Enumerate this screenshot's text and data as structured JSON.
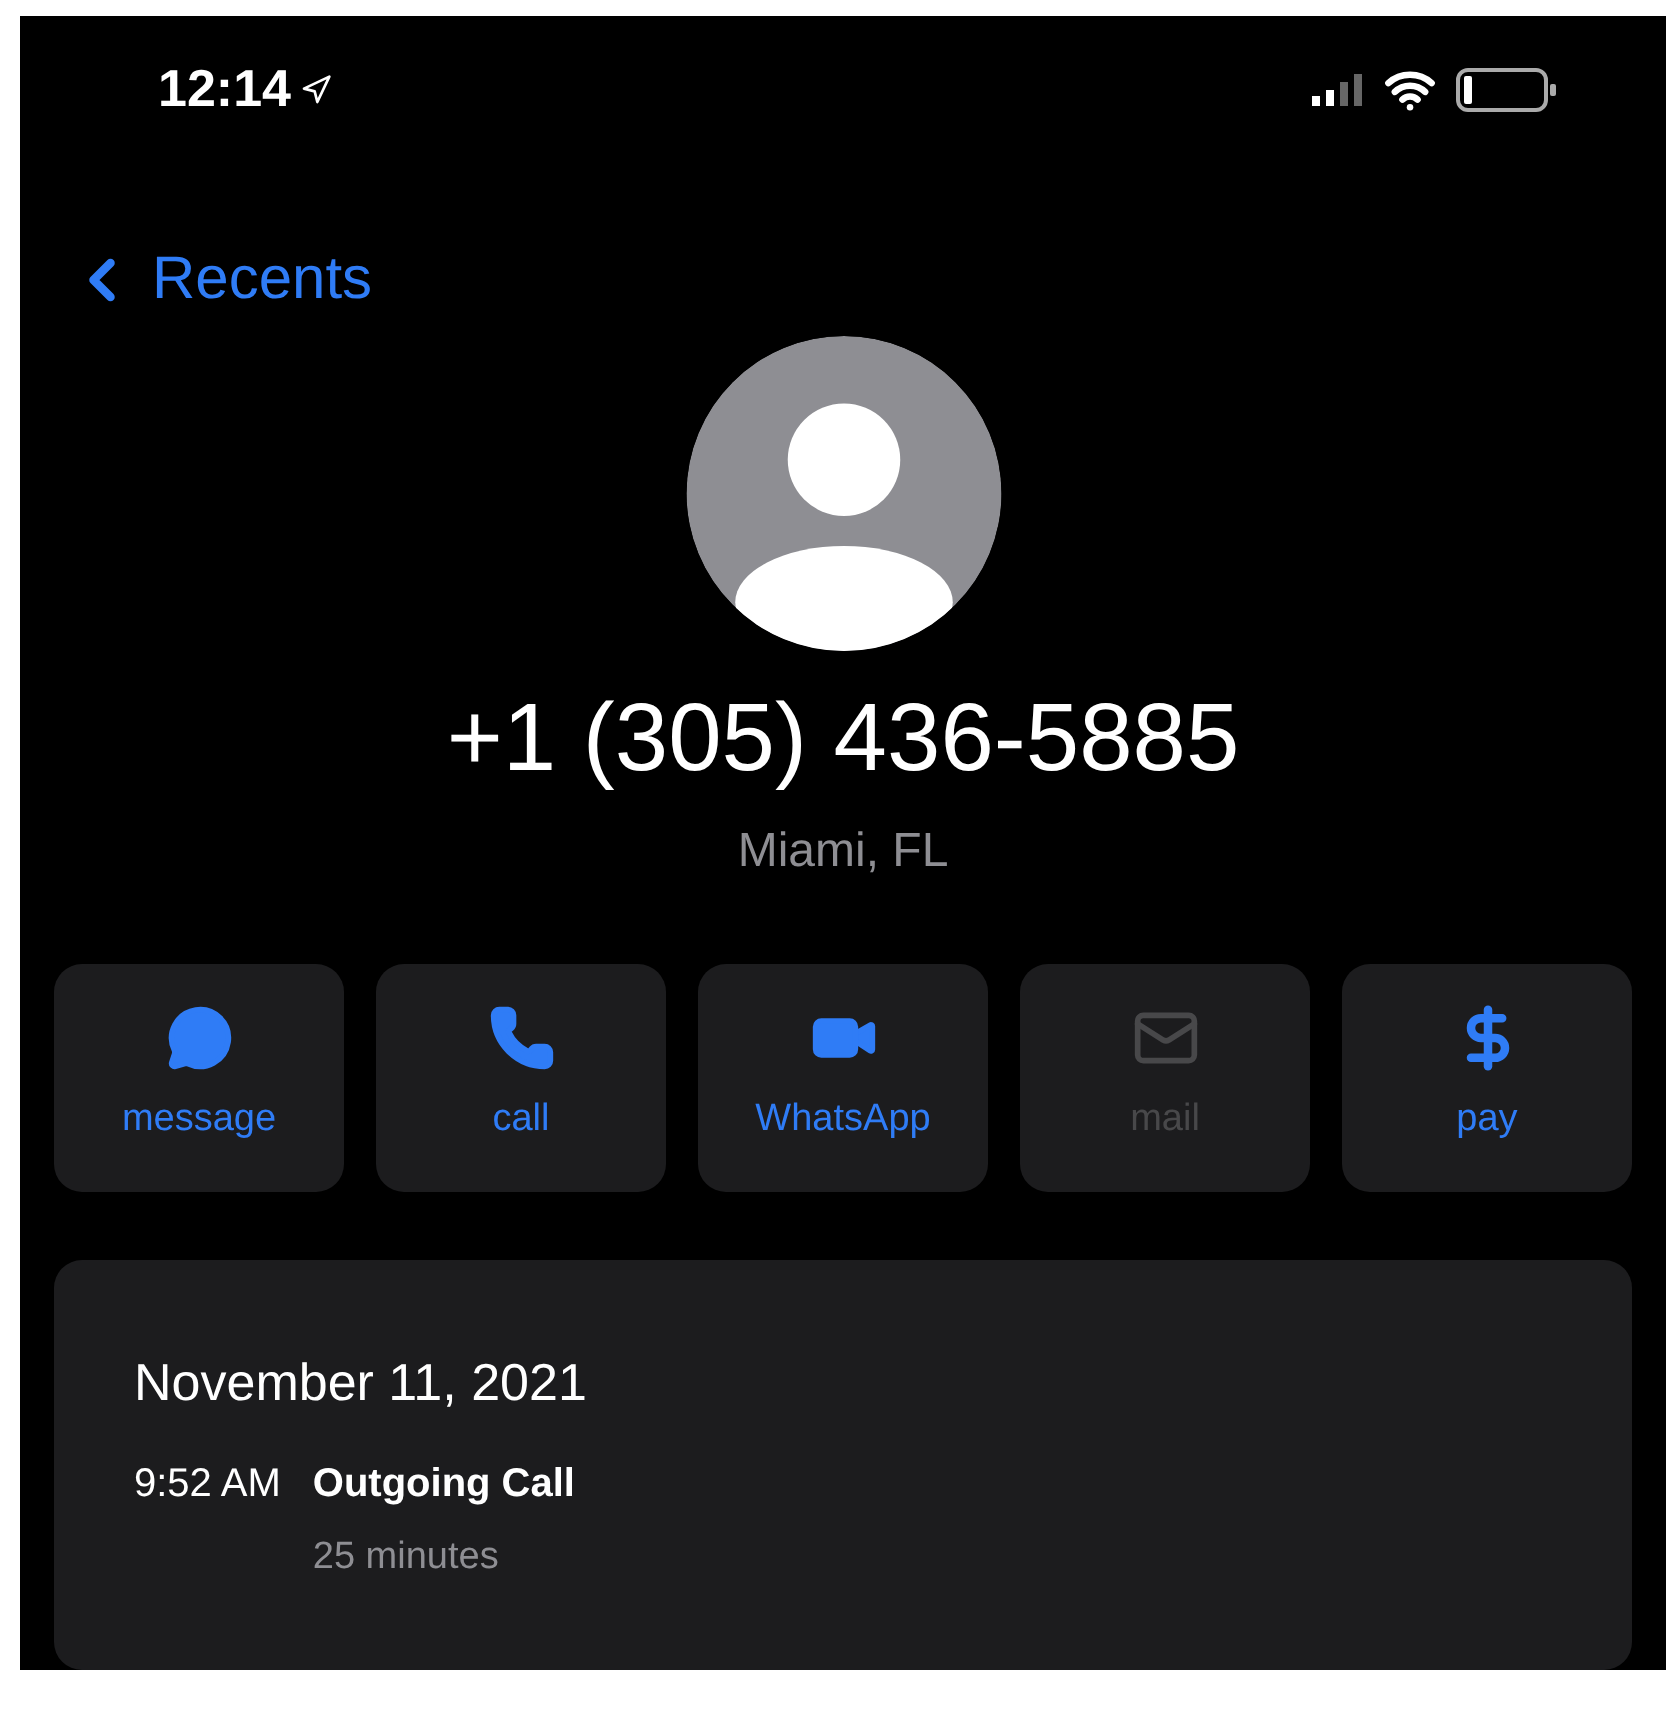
{
  "status_bar": {
    "time": "12:14"
  },
  "back": {
    "label": "Recents"
  },
  "contact": {
    "number": "+1 (305) 436-5885",
    "location": "Miami, FL"
  },
  "actions": [
    {
      "label": "message",
      "kind": "message",
      "disabled": false
    },
    {
      "label": "call",
      "kind": "call",
      "disabled": false
    },
    {
      "label": "WhatsApp",
      "kind": "video",
      "disabled": false
    },
    {
      "label": "mail",
      "kind": "mail",
      "disabled": true
    },
    {
      "label": "pay",
      "kind": "pay",
      "disabled": false
    }
  ],
  "history": {
    "date": "November 11, 2021",
    "entries": [
      {
        "time": "9:52 AM",
        "type": "Outgoing Call",
        "duration": "25 minutes"
      }
    ]
  }
}
